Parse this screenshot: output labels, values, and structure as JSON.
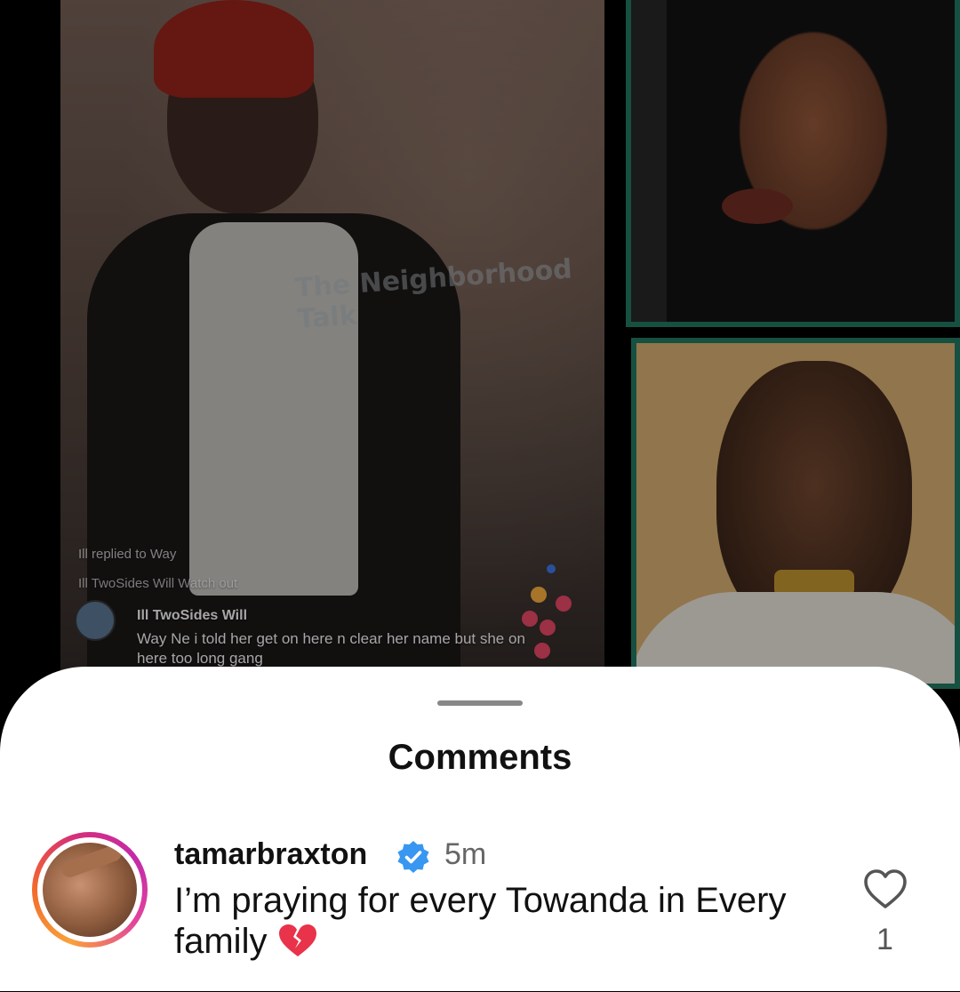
{
  "background_media": {
    "overlay": {
      "replied_label": "Ill replied to Way",
      "pinned_comment": "Ill TwoSides Will Watch out",
      "live_comment_user": "Ill TwoSides Will",
      "live_comment_text": "Way Ne i told her get on here n clear her name but she on here too long gang",
      "watermark": "The Neighborhood Talk"
    },
    "frame_color": "#1f6f5a"
  },
  "comments_sheet": {
    "title": "Comments",
    "comments": [
      {
        "username": "tamarbraxton",
        "verified": true,
        "time": "5m",
        "text": "I’m praying for every Towanda in Every family",
        "emoji_icon": "broken-heart-icon",
        "likes": "1"
      }
    ]
  },
  "colors": {
    "sheet_background": "#ffffff",
    "verified_blue": "#3897f0",
    "text_primary": "#111111",
    "text_secondary": "#666666"
  }
}
